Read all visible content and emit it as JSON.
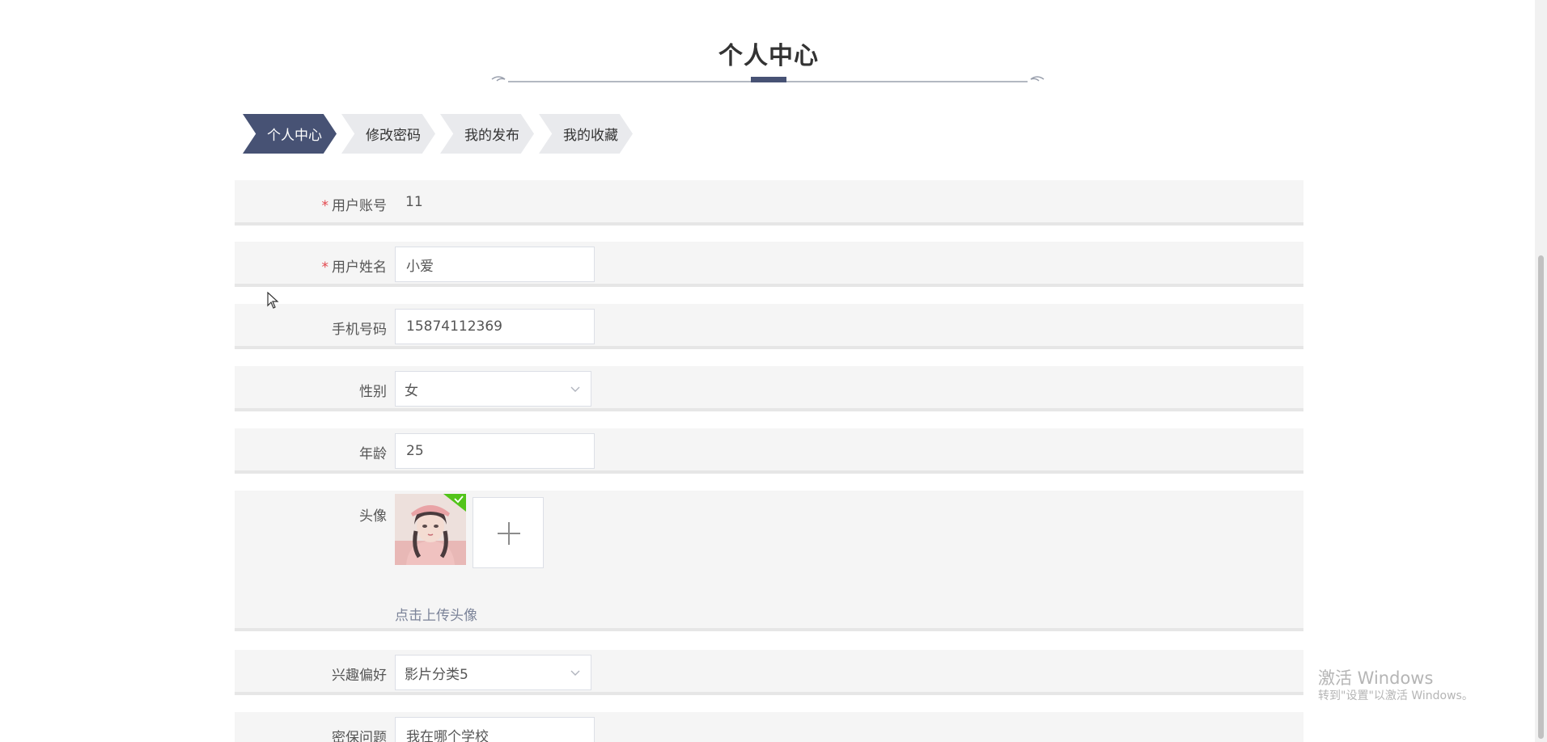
{
  "page": {
    "title": "个人中心"
  },
  "tabs": [
    {
      "label": "个人中心",
      "active": true
    },
    {
      "label": "修改密码",
      "active": false
    },
    {
      "label": "我的发布",
      "active": false
    },
    {
      "label": "我的收藏",
      "active": false
    }
  ],
  "form": {
    "account": {
      "label": "用户账号",
      "required_mark": "*",
      "value": "11"
    },
    "name": {
      "label": "用户姓名",
      "required_mark": "*",
      "value": "小爱"
    },
    "phone": {
      "label": "手机号码",
      "value": "15874112369"
    },
    "gender": {
      "label": "性别",
      "value": "女"
    },
    "age": {
      "label": "年龄",
      "value": "25"
    },
    "avatar": {
      "label": "头像",
      "upload_hint": "点击上传头像"
    },
    "interest": {
      "label": "兴趣偏好",
      "value": "影片分类5"
    },
    "security_question": {
      "label": "密保问题",
      "value": "我在哪个学校"
    }
  },
  "watermark": {
    "title": "激活 Windows",
    "subtitle": "转到\"设置\"以激活 Windows。"
  },
  "icons": {
    "chevron": "chevron-down-icon",
    "plus": "plus-icon",
    "check": "check-icon",
    "cursor": "mouse-cursor-icon"
  },
  "colors": {
    "accent": "#475274",
    "required": "#e2454b",
    "success": "#52c41a",
    "row_bg": "#f5f5f5"
  }
}
